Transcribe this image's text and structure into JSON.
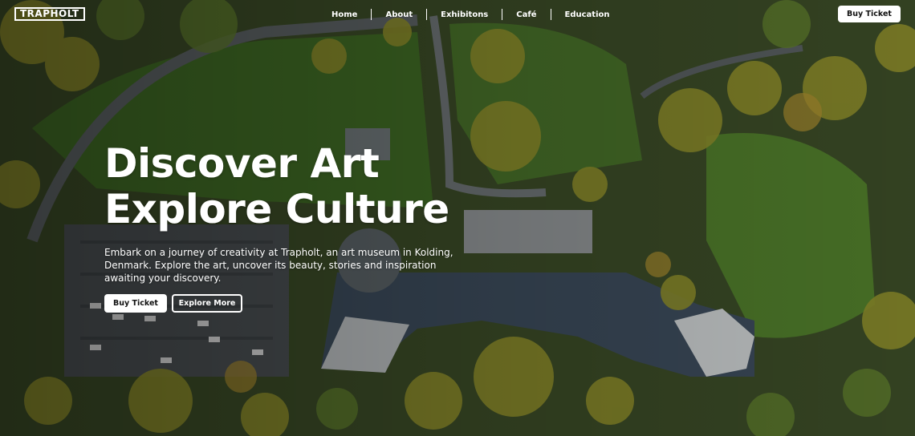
{
  "brand": {
    "logo": "TRAPHOLT"
  },
  "nav": {
    "items": [
      "Home",
      "About",
      "Exhibitons",
      "Café",
      "Education"
    ]
  },
  "header": {
    "ticket_label": "Buy Ticket"
  },
  "hero": {
    "line1": "Discover Art",
    "line2": "Explore Culture",
    "description": "Embark on a journey of creativity at Trapholt, an art museum in Kolding, Denmark. Explore the art, uncover its beauty, stories and inspiration awaiting your discovery.",
    "primary_cta": "Buy Ticket",
    "secondary_cta": "Explore More",
    "background": "aerial-view-of-museum-grounds"
  },
  "colors": {
    "text": "#ffffff",
    "button_bg": "#ffffff",
    "button_text": "#111111",
    "grass": "#4f6b2c",
    "trees": "#8a8a2a"
  }
}
